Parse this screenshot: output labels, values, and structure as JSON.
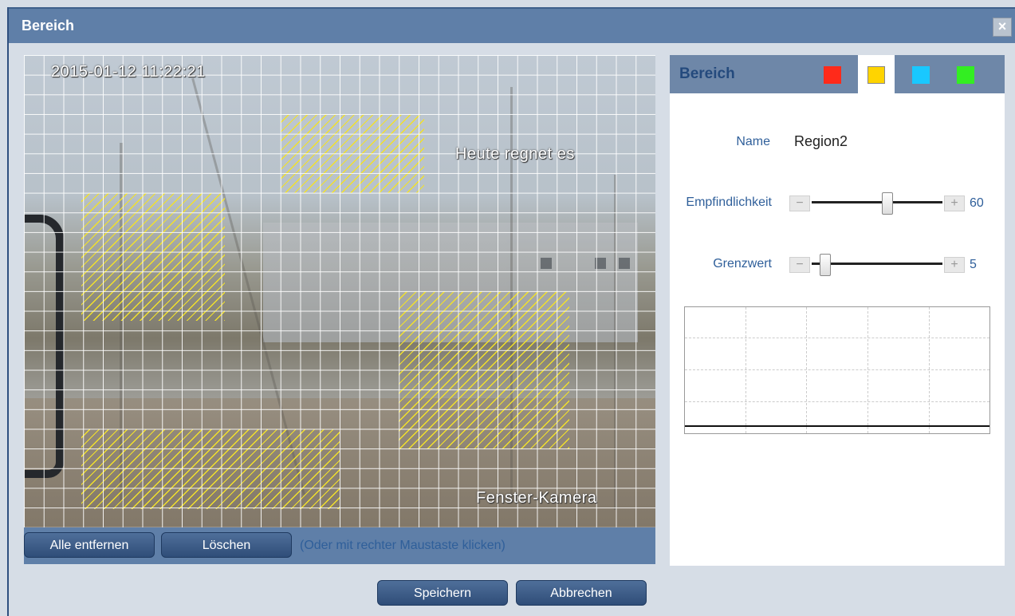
{
  "window": {
    "title": "Bereich"
  },
  "video": {
    "timestamp": "2015-01-12 11:22:21",
    "overlay_text": "Heute regnet es",
    "camera_name": "Fenster-Kamera"
  },
  "actions": {
    "remove_all_label": "Alle entfernen",
    "delete_label": "Löschen",
    "hint": "(Oder mit rechter Maustaste klicken)",
    "save_label": "Speichern",
    "cancel_label": "Abbrechen"
  },
  "panel": {
    "title": "Bereich",
    "region_colors": [
      "#ff2a1a",
      "#ffd400",
      "#19c8ff",
      "#33ee22"
    ],
    "active_region_index": 1,
    "name_label": "Name",
    "name_value": "Region2",
    "sensitivity_label": "Empfindlichkeit",
    "sensitivity_value": "60",
    "threshold_label": "Grenzwert",
    "threshold_value": "5",
    "minus": "−",
    "plus": "+"
  },
  "colors": {
    "hatch": "#f2e12a",
    "titlebar": "#5f7fa8",
    "accent_text": "#2f5f9a"
  }
}
